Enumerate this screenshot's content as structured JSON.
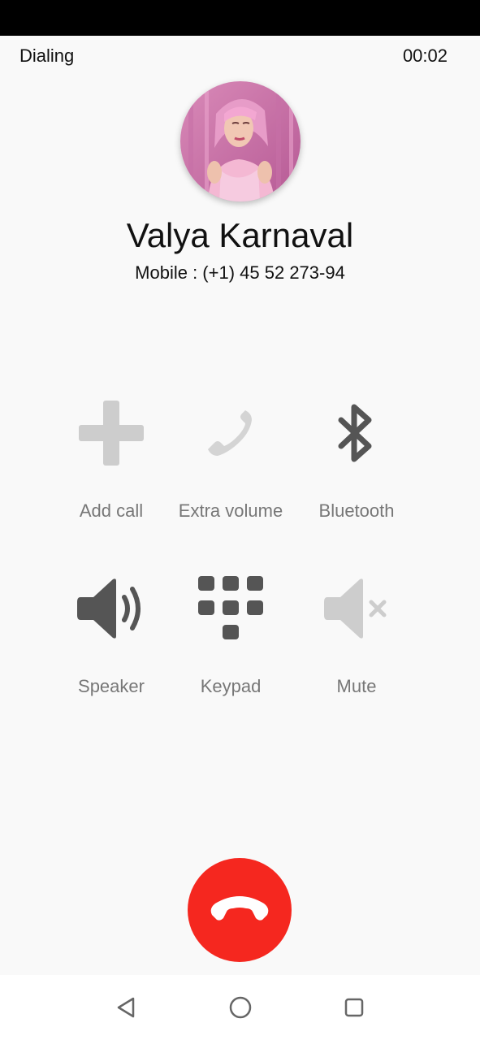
{
  "call": {
    "state": "Dialing",
    "timer": "00:02"
  },
  "contact": {
    "name": "Valya Karnaval",
    "number": "Mobile : (+1) 45 52 273-94"
  },
  "actions": [
    {
      "label": "Add call",
      "icon": "plus-icon"
    },
    {
      "label": "Extra volume",
      "icon": "phone-icon"
    },
    {
      "label": "Bluetooth",
      "icon": "bluetooth-icon"
    },
    {
      "label": "Speaker",
      "icon": "speaker-icon"
    },
    {
      "label": "Keypad",
      "icon": "keypad-icon"
    },
    {
      "label": "Mute",
      "icon": "mute-icon"
    }
  ],
  "end_call": {
    "icon": "hang-up-icon",
    "color": "#f5271f"
  },
  "nav": {
    "back": "back-triangle-icon",
    "home": "home-circle-icon",
    "recents": "recents-square-icon"
  }
}
